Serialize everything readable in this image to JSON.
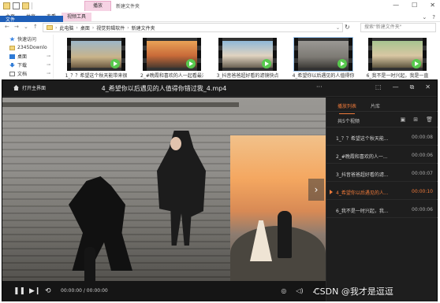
{
  "explorer": {
    "context_tab": "播放",
    "title": "新建文件夹",
    "window_controls": [
      "—",
      "☐",
      "✕"
    ],
    "ribbon_tabs": [
      "文件",
      "主页",
      "共享",
      "查看",
      "视频工具"
    ],
    "ribbon_right": [
      "⌄",
      "?"
    ],
    "address": {
      "nav": [
        "←",
        "→",
        "⌄",
        "↑"
      ],
      "path": [
        "此电脑",
        "桌面",
        "视觉剪辑软件",
        "新建文件夹"
      ],
      "search_placeholder": "搜索\"新建文件夹\""
    },
    "nav_pane": [
      {
        "label": "快速访问",
        "icon": "star-icon",
        "pin": ""
      },
      {
        "label": "2345Downlo",
        "icon": "folder-icon",
        "pin": ""
      },
      {
        "label": "桌面",
        "icon": "desktop-icon",
        "pin": "⊸"
      },
      {
        "label": "下载",
        "icon": "download-icon",
        "pin": "⊸"
      },
      {
        "label": "文档",
        "icon": "documents-icon",
        "pin": "⊸"
      }
    ],
    "files": [
      {
        "name": "1_？？希望这个秋天能带来很",
        "scene": "linear-gradient(180deg,#9db6c8 0%,#c9b48a 60%,#6c5a43 100%)"
      },
      {
        "name": "2_#晚霞和喜欢的人一起看最浪",
        "scene": "linear-gradient(180deg,#e9a257 0%,#c96a39 55%,#4b3a2f 100%)"
      },
      {
        "name": "3_抖音爸爸超好看的滤镜快点",
        "scene": "linear-gradient(180deg,#8fb8d8 0%,#e0d3c0 55%,#6a6153 100%)"
      },
      {
        "name": "4_希望你以后遇见的人值得你",
        "scene": "linear-gradient(180deg,#9a9894 0%,#7d7a74 60%,#3f3d39 100%)"
      },
      {
        "name": "6_我不是一时兴起，我是一直",
        "scene": "linear-gradient(180deg,#a7c48f 0%,#d9c7a3 55%,#5f5640 100%)"
      }
    ]
  },
  "player": {
    "home_label": "打开主界面",
    "title": "4_希望你以后遇见的人值得你错过我_4.mp4",
    "more": "···",
    "window_controls": [
      "⬚",
      "—",
      "⧉",
      "✕"
    ],
    "next_arrow": "›",
    "controls": {
      "pause": "❚❚",
      "next": "▶❙",
      "loop": "⟲",
      "time": "00:00:00 / 00:00:00",
      "right": [
        "◎",
        "◁)",
        "⤢"
      ]
    },
    "playlist": {
      "tabs": [
        "播放列表",
        "片库"
      ],
      "count": "共5个视频",
      "icons": [
        "▣",
        "⊞",
        "🗑"
      ],
      "items": [
        {
          "name": "1_？？希望这个秋天能...",
          "duration": "00:00:08",
          "active": false
        },
        {
          "name": "2_#晚霞和喜欢的人一...",
          "duration": "00:00:06",
          "active": false
        },
        {
          "name": "3_抖音爸爸超好看的滤...",
          "duration": "00:00:07",
          "active": false
        },
        {
          "name": "4_希望你以后遇见的人...",
          "duration": "00:00:10",
          "active": true
        },
        {
          "name": "6_我不是一时兴起，我...",
          "duration": "00:00:06",
          "active": false
        }
      ]
    }
  },
  "watermark": "CSDN @我才是逗逗"
}
